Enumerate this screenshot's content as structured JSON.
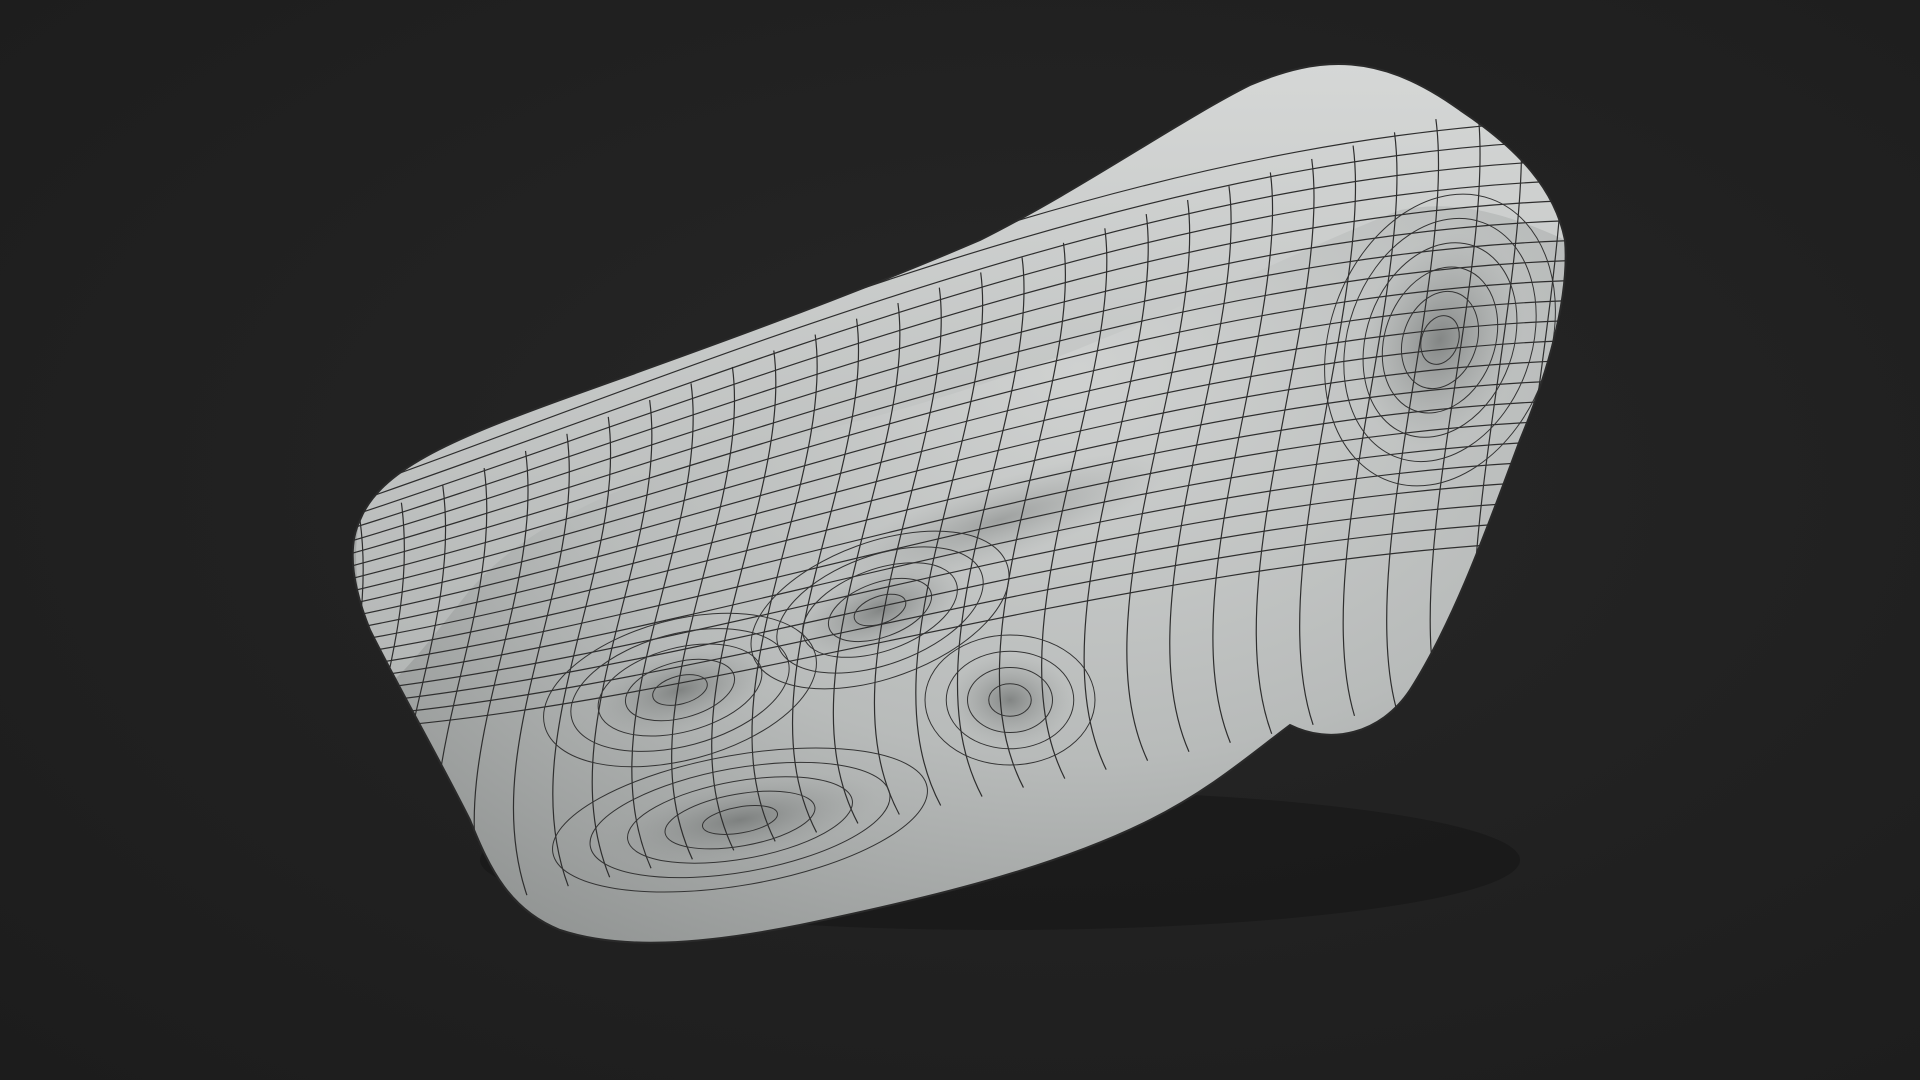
{
  "scene": {
    "background_color": "#232323",
    "mesh_color": "#b9bcbb",
    "wire_color": "#2e2e2e",
    "subject": "wireframe-mesh-face-scan"
  }
}
